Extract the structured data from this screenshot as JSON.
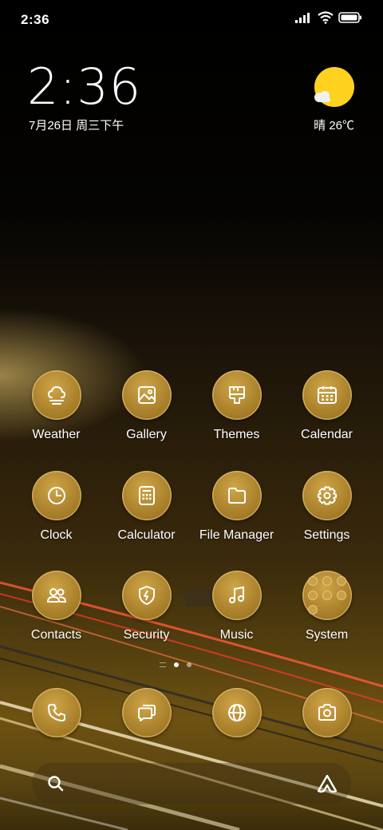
{
  "status_bar": {
    "time": "2:36"
  },
  "lock_widget": {
    "time": "2:36",
    "date": "7月26日 周三下午",
    "weather": {
      "condition": "晴",
      "temperature": "26℃",
      "icon": "sun-cloud-icon"
    }
  },
  "apps": [
    {
      "label": "Weather",
      "icon": "weather-icon"
    },
    {
      "label": "Gallery",
      "icon": "gallery-icon"
    },
    {
      "label": "Themes",
      "icon": "themes-icon"
    },
    {
      "label": "Calendar",
      "icon": "calendar-icon"
    },
    {
      "label": "Clock",
      "icon": "clock-icon"
    },
    {
      "label": "Calculator",
      "icon": "calculator-icon"
    },
    {
      "label": "File Manager",
      "icon": "folder-icon"
    },
    {
      "label": "Settings",
      "icon": "gear-icon"
    },
    {
      "label": "Contacts",
      "icon": "contacts-icon"
    },
    {
      "label": "Security",
      "icon": "shield-icon"
    },
    {
      "label": "Music",
      "icon": "music-icon"
    },
    {
      "label": "System",
      "icon": "folder-group-icon"
    }
  ],
  "dock": [
    {
      "icon": "phone-icon"
    },
    {
      "icon": "messages-icon"
    },
    {
      "icon": "browser-icon"
    },
    {
      "icon": "camera-icon"
    }
  ],
  "page_indicator": {
    "pages": 3,
    "active": 2
  },
  "colors": {
    "accent_gold": "#b8892e",
    "sun": "#ffd21f"
  }
}
